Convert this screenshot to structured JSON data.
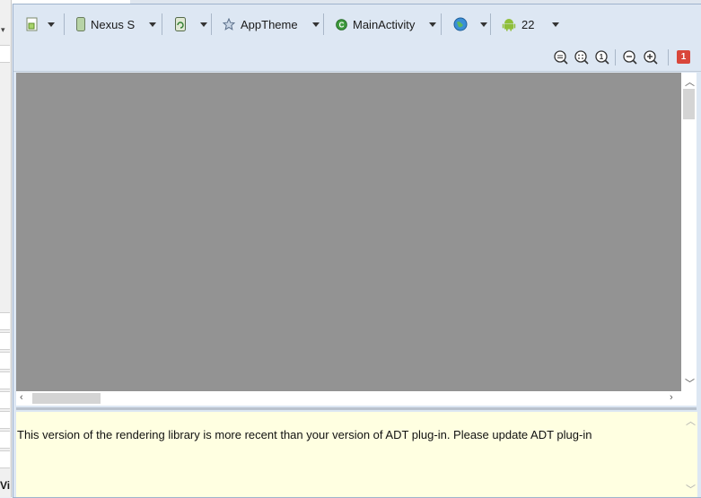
{
  "toolbar": {
    "device": "Nexus S",
    "theme": "AppTheme",
    "activity": "MainActivity",
    "api_level": "22"
  },
  "zoom": {
    "error_count": "1"
  },
  "message": {
    "text": "This version of the rendering library is more recent than your version of ADT plug-in. Please update ADT plug-in"
  },
  "left_panel": {
    "partial_label": "Vi"
  },
  "colors": {
    "canvas": "#939393",
    "message_bg": "#ffffe1",
    "error_badge": "#d9463a"
  },
  "icons": [
    "layout-config-icon",
    "device-phone-icon",
    "orientation-icon",
    "theme-star-icon",
    "activity-icon",
    "globe-icon",
    "android-icon",
    "zoom-fit-icon",
    "zoom-real-icon",
    "zoom-100-icon",
    "zoom-out-icon",
    "zoom-in-icon"
  ]
}
